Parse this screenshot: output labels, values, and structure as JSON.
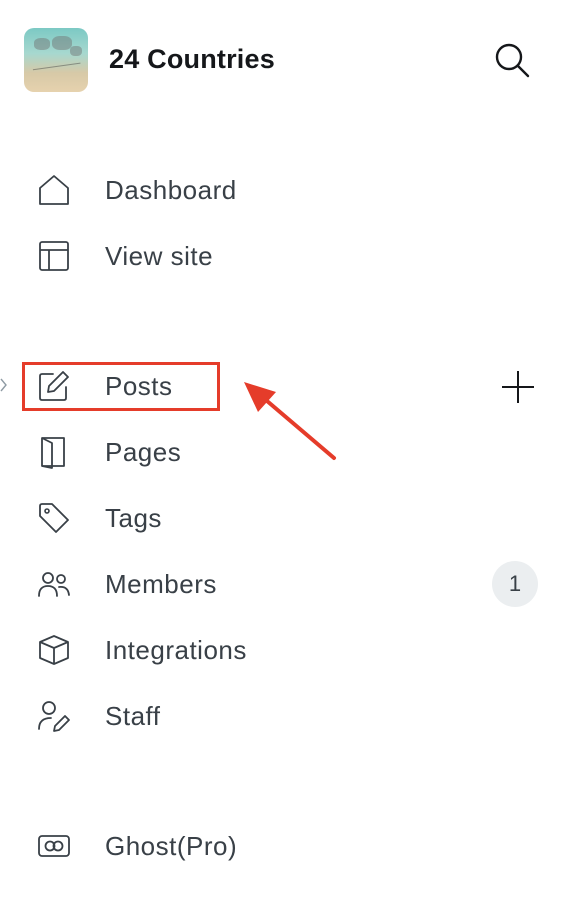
{
  "site": {
    "title": "24 Countries"
  },
  "nav_primary": [
    {
      "id": "dashboard",
      "label": "Dashboard",
      "icon": "home-icon"
    },
    {
      "id": "view-site",
      "label": "View site",
      "icon": "layout-icon"
    }
  ],
  "nav_content": [
    {
      "id": "posts",
      "label": "Posts",
      "icon": "edit-icon"
    },
    {
      "id": "pages",
      "label": "Pages",
      "icon": "page-icon"
    },
    {
      "id": "tags",
      "label": "Tags",
      "icon": "tag-icon"
    },
    {
      "id": "members",
      "label": "Members",
      "icon": "members-icon",
      "count": "1"
    },
    {
      "id": "integrations",
      "label": "Integrations",
      "icon": "box-icon"
    },
    {
      "id": "staff",
      "label": "Staff",
      "icon": "staff-icon"
    }
  ],
  "nav_footer": [
    {
      "id": "ghost-pro",
      "label": "Ghost(Pro)",
      "icon": "ghost-pro-icon"
    }
  ],
  "annotation": {
    "highlight_color": "#e53c2a",
    "highlighted_item": "Posts"
  },
  "colors": {
    "text": "#394047",
    "title": "#15171a",
    "badge_bg": "#ebeef0",
    "annotation": "#e53c2a"
  }
}
